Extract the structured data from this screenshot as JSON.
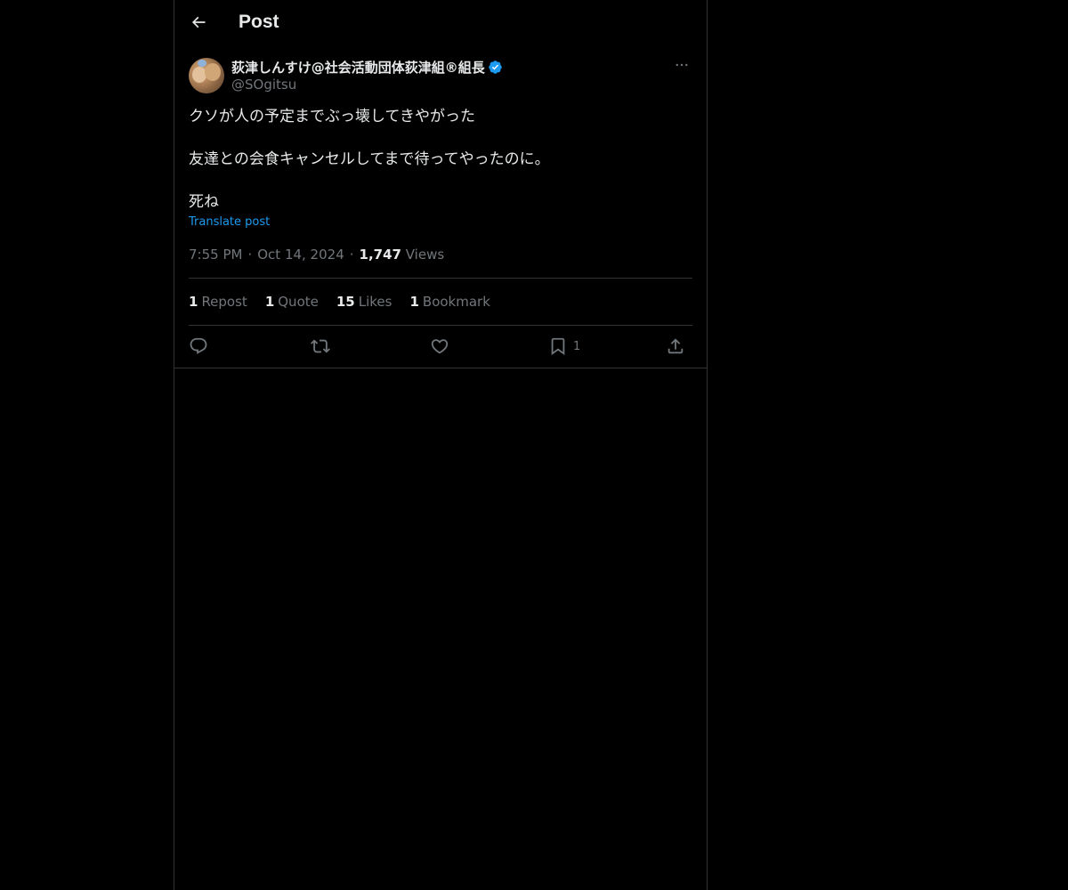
{
  "header": {
    "title": "Post",
    "back_icon": "arrow-left-icon"
  },
  "author": {
    "display_name": "荻津しんすけ@社会活動団体荻津組®組長",
    "handle": "@SOgitsu",
    "verified": true,
    "verified_color": "#1d9bf0",
    "more_icon": "more-horizontal-icon"
  },
  "tweet": {
    "lines": [
      "クソが人の予定までぶっ壊してきやがった",
      "友達との会食キャンセルしてまで待ってやったのに。",
      "死ね"
    ],
    "translate_label": "Translate post"
  },
  "meta": {
    "time": "7:55 PM",
    "date": "Oct 14, 2024",
    "views_count": "1,747",
    "views_label": "Views"
  },
  "stats": {
    "reposts_count": "1",
    "reposts_label": "Repost",
    "quotes_count": "1",
    "quotes_label": "Quote",
    "likes_count": "15",
    "likes_label": "Likes",
    "bookmarks_count": "1",
    "bookmarks_label": "Bookmark"
  },
  "actions": {
    "reply_icon": "reply-icon",
    "repost_icon": "repost-icon",
    "like_icon": "heart-icon",
    "bookmark_icon": "bookmark-icon",
    "bookmark_count": "1",
    "share_icon": "share-icon"
  },
  "colors": {
    "background": "#000000",
    "text": "#e7e9ea",
    "secondary": "#71767b",
    "accent": "#1d9bf0",
    "border": "#2f3336"
  }
}
